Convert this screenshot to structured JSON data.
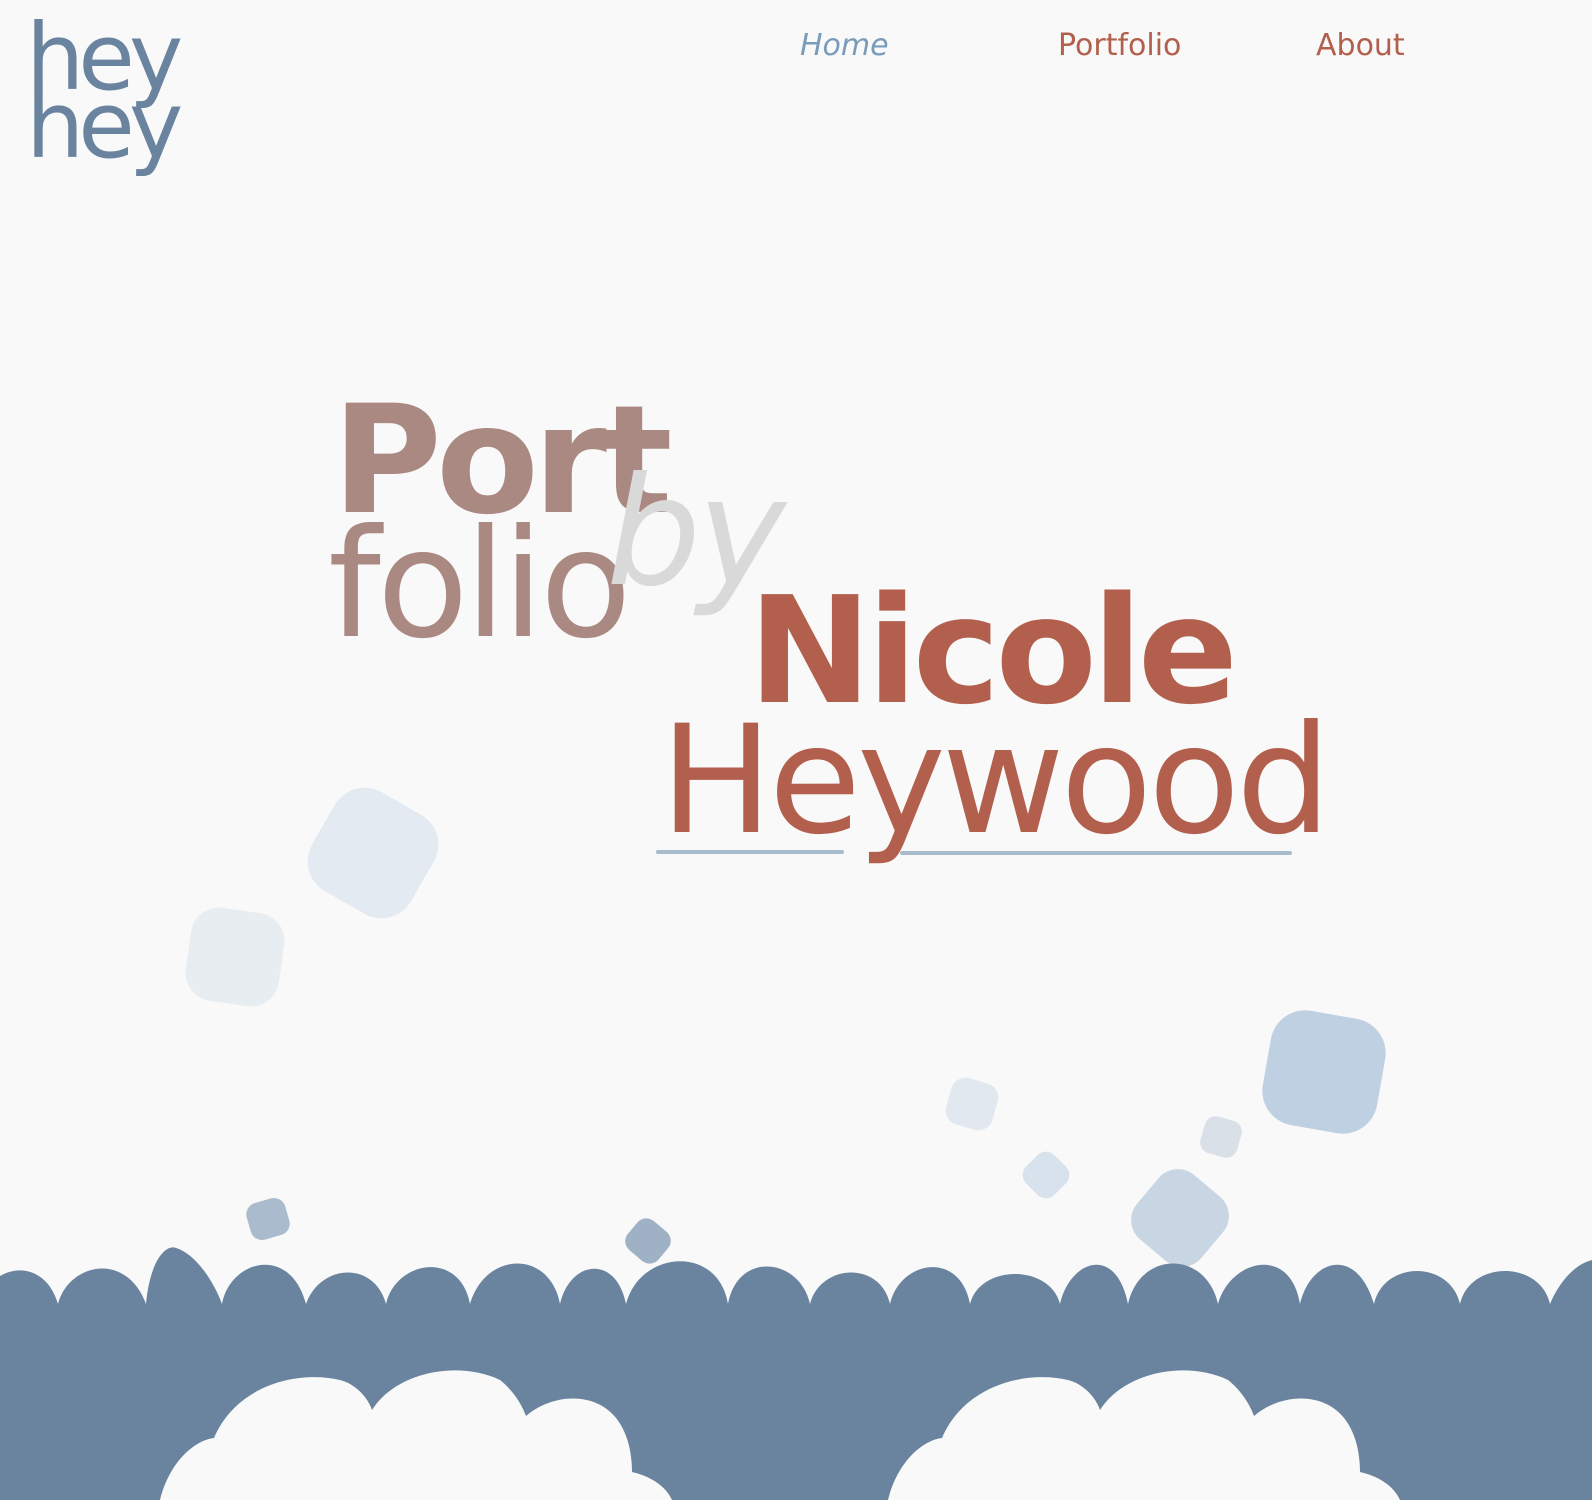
{
  "logo": {
    "line1": "hey",
    "line2": "hey"
  },
  "nav": {
    "home": "Home",
    "portfolio": "Portfolio",
    "about": "About"
  },
  "hero": {
    "port": "Port",
    "folio": "folio",
    "by": "by",
    "first_name": "Nicole",
    "last_name": "Heywood"
  },
  "colors": {
    "background": "#f8f9f8",
    "logo_blue": "#6a84a0",
    "nav_active": "#7b9bbb",
    "accent_red": "#b35f4d",
    "muted_rose": "#ab8983",
    "light_gray": "#d9d9d9",
    "footer_blue": "#6a84a0"
  }
}
